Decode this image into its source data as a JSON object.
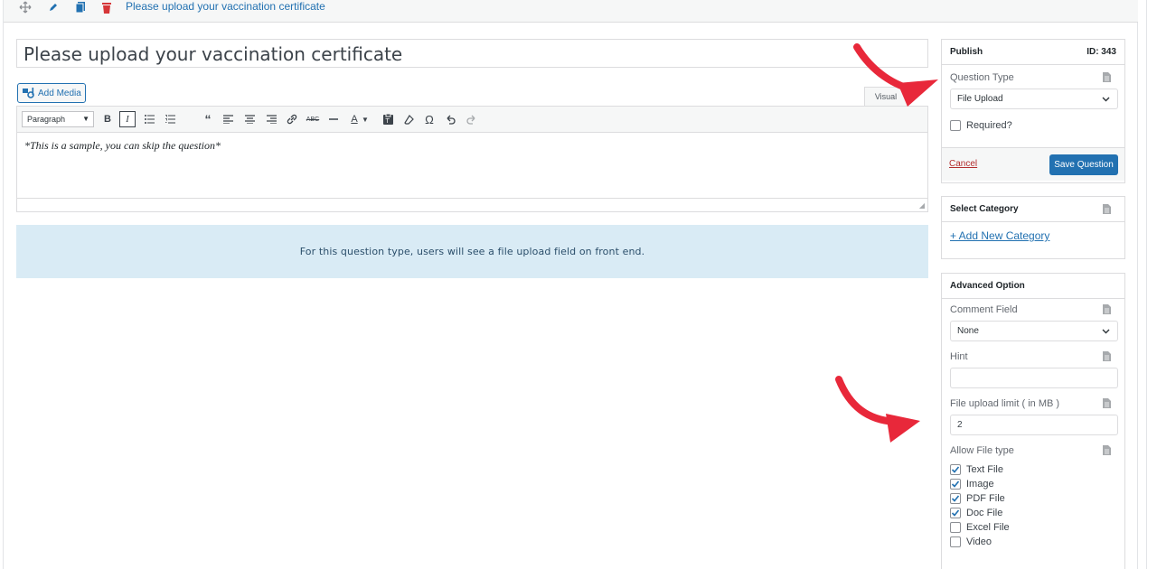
{
  "topbar": {
    "title": "Please upload your vaccination certificate",
    "icons": [
      "move-icon",
      "pencil-icon",
      "duplicate-icon",
      "trash-icon"
    ]
  },
  "editor": {
    "title_value": "Please upload your vaccination certificate",
    "add_media_label": "Add Media",
    "visual_tab_label": "Visual",
    "format_value": "Paragraph",
    "body_text": "*This is a sample, you can skip the question*",
    "toolbar_icons": [
      "bold-icon",
      "italic-icon",
      "bullet-list-icon",
      "numbered-list-icon",
      "blockquote-icon",
      "align-left-icon",
      "align-center-icon",
      "align-right-icon",
      "link-icon",
      "strikethrough-icon",
      "horizontal-line-icon",
      "text-color-icon",
      "paste-text-icon",
      "clear-formatting-icon",
      "special-character-icon",
      "undo-icon",
      "redo-icon"
    ]
  },
  "notice": {
    "text": "For this question type, users will see a file upload field on front end."
  },
  "publish": {
    "heading": "Publish",
    "id_label": "ID: 343",
    "question_type_label": "Question Type",
    "question_type_value": "File Upload",
    "required_label": "Required?",
    "required_checked": false,
    "cancel_label": "Cancel",
    "save_label": "Save Question"
  },
  "category": {
    "heading": "Select Category",
    "add_label": "+ Add New Category"
  },
  "advanced": {
    "heading": "Advanced Option",
    "comment_field_label": "Comment Field",
    "comment_field_value": "None",
    "hint_label": "Hint",
    "hint_value": "",
    "upload_limit_label": "File upload limit ( in MB )",
    "upload_limit_value": "2",
    "allow_type_label": "Allow File type",
    "file_types": [
      {
        "label": "Text File",
        "checked": true
      },
      {
        "label": "Image",
        "checked": true
      },
      {
        "label": "PDF File",
        "checked": true
      },
      {
        "label": "Doc File",
        "checked": true
      },
      {
        "label": "Excel File",
        "checked": false
      },
      {
        "label": "Video",
        "checked": false
      }
    ]
  },
  "colors": {
    "accent": "#2271b1",
    "danger": "#b32d2e",
    "notice_bg": "#d9ebf5",
    "arrow": "#e8283a"
  }
}
